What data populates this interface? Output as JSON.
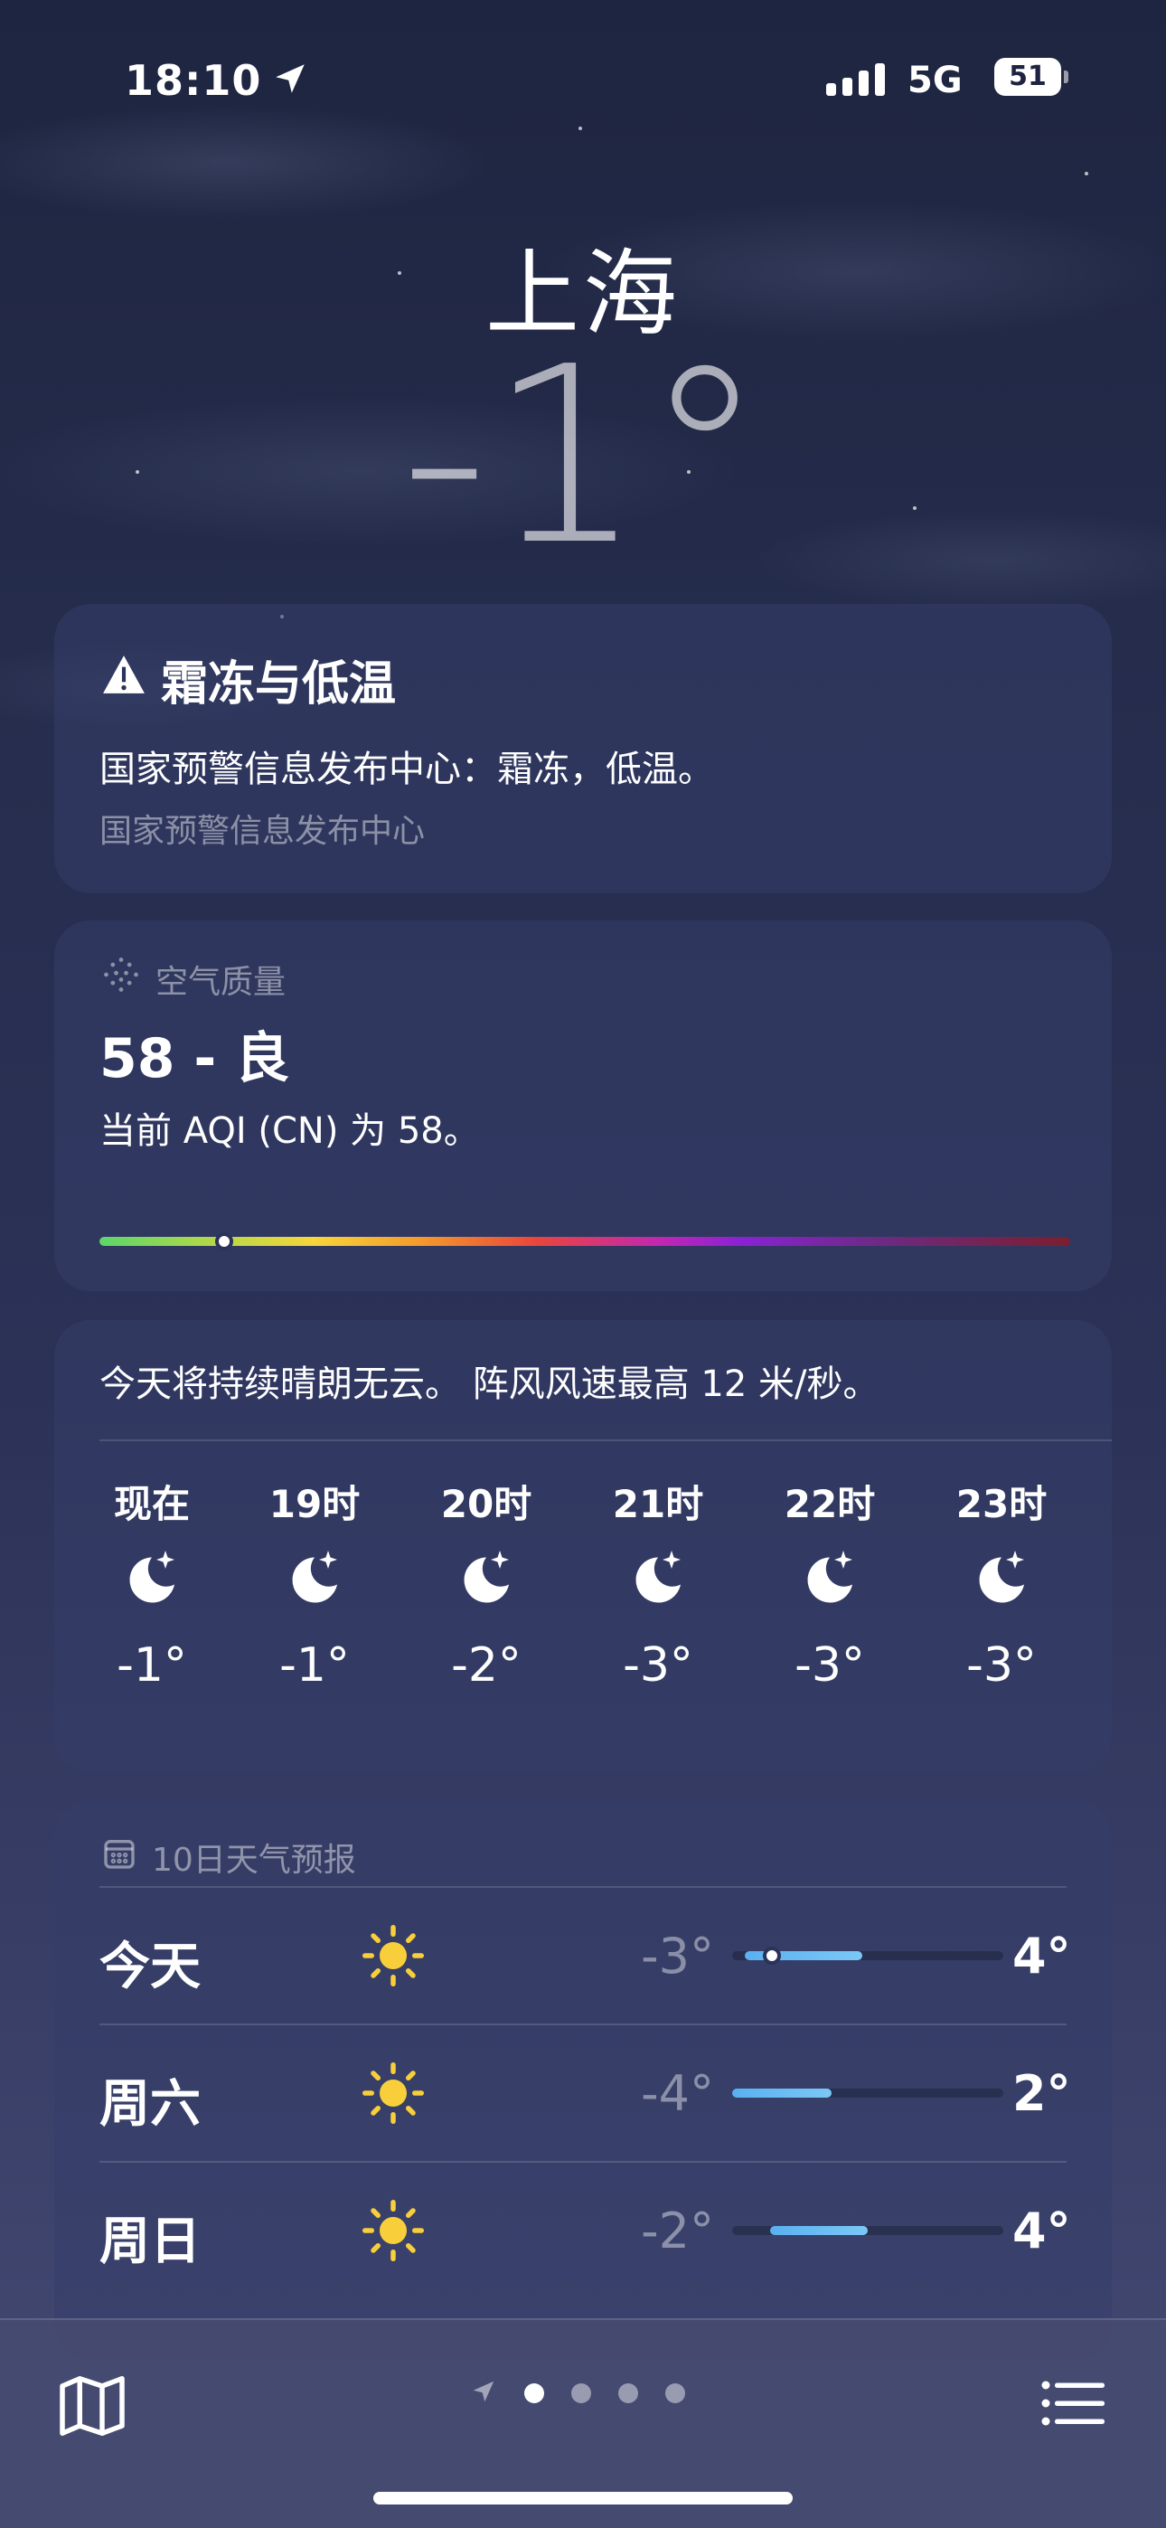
{
  "status": {
    "time": "18:10",
    "network": "5G",
    "battery": "51"
  },
  "header": {
    "city": "上海",
    "temperature": "-1°"
  },
  "alert": {
    "icon": "warning-triangle-icon",
    "title": "霜冻与低温",
    "description": "国家预警信息发布中心：霜冻，低温。",
    "source": "国家预警信息发布中心"
  },
  "air_quality": {
    "header": "空气质量",
    "value": "58 - 良",
    "description": "当前 AQI (CN) 为 58。",
    "aqi": 58
  },
  "hourly": {
    "summary": "今天将持续晴朗无云。 阵风风速最高 12 米/秒。",
    "items": [
      {
        "hour": "现在",
        "icon": "moon-stars-icon",
        "temp": "-1°"
      },
      {
        "hour": "19时",
        "icon": "moon-stars-icon",
        "temp": "-1°"
      },
      {
        "hour": "20时",
        "icon": "moon-stars-icon",
        "temp": "-2°"
      },
      {
        "hour": "21时",
        "icon": "moon-stars-icon",
        "temp": "-3°"
      },
      {
        "hour": "22时",
        "icon": "moon-stars-icon",
        "temp": "-3°"
      },
      {
        "hour": "23时",
        "icon": "moon-stars-icon",
        "temp": "-3°"
      }
    ]
  },
  "ten_day": {
    "header": "10日天气预报",
    "rows": [
      {
        "day": "今天",
        "icon": "sun-icon",
        "low": "-3°",
        "high": "4°",
        "current": "-1°"
      },
      {
        "day": "周六",
        "icon": "sun-icon",
        "low": "-4°",
        "high": "2°"
      },
      {
        "day": "周日",
        "icon": "sun-icon",
        "low": "-2°",
        "high": "4°"
      }
    ]
  },
  "toolbar": {
    "map_icon": "map-icon",
    "list_icon": "list-icon",
    "location_icon": "location-arrow-icon",
    "page_count": 4,
    "active_page": 1
  }
}
